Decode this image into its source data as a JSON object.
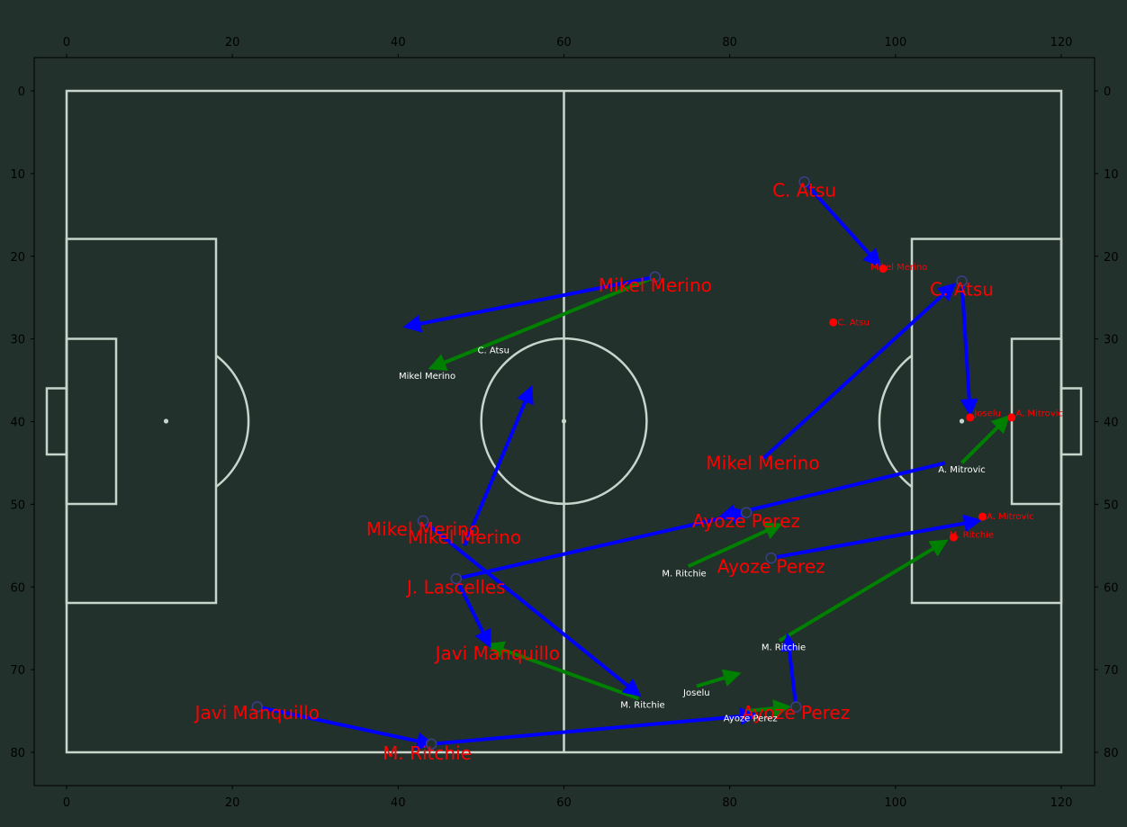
{
  "x_ticks": [
    "0",
    "20",
    "40",
    "60",
    "80",
    "100",
    "120"
  ],
  "y_ticks": [
    "0",
    "10",
    "20",
    "30",
    "40",
    "50",
    "60",
    "70",
    "80"
  ],
  "colors": {
    "background": "#22312b",
    "pitch_lines": "#c7d5cc",
    "pass_arrow": "#0000ff",
    "carry_arrow": "#008000",
    "label_red": "#ff0000",
    "label_white": "#ffffff"
  },
  "passes": [
    {
      "from": [
        71,
        22.5
      ],
      "to": [
        41,
        28.5
      ]
    },
    {
      "from": [
        89,
        11
      ],
      "to": [
        98,
        21
      ]
    },
    {
      "from": [
        108,
        23
      ],
      "to": [
        109,
        39
      ]
    },
    {
      "from": [
        84,
        44.5
      ],
      "to": [
        107,
        23.5
      ]
    },
    {
      "from": [
        106,
        45
      ],
      "to": [
        79,
        51.5
      ]
    },
    {
      "from": [
        85,
        56.5
      ],
      "to": [
        110,
        52
      ]
    },
    {
      "from": [
        47,
        59
      ],
      "to": [
        82,
        51
      ]
    },
    {
      "from": [
        47,
        59
      ],
      "to": [
        51,
        67
      ]
    },
    {
      "from": [
        48,
        55
      ],
      "to": [
        56,
        36
      ]
    },
    {
      "from": [
        43,
        52
      ],
      "to": [
        69,
        73
      ]
    },
    {
      "from": [
        23,
        74.5
      ],
      "to": [
        44,
        79
      ]
    },
    {
      "from": [
        44,
        79
      ],
      "to": [
        83,
        75.5
      ]
    },
    {
      "from": [
        88,
        74.5
      ],
      "to": [
        87,
        66
      ]
    }
  ],
  "carries": [
    {
      "from": [
        71,
        22.5
      ],
      "to": [
        44,
        33.5
      ]
    },
    {
      "from": [
        69,
        73.5
      ],
      "to": [
        51,
        67
      ]
    },
    {
      "from": [
        75,
        57.5
      ],
      "to": [
        86,
        52.5
      ]
    },
    {
      "from": [
        76,
        72
      ],
      "to": [
        81,
        70.5
      ]
    },
    {
      "from": [
        82,
        75
      ],
      "to": [
        87,
        74.5
      ]
    },
    {
      "from": [
        86,
        66.5
      ],
      "to": [
        106,
        54.5
      ]
    },
    {
      "from": [
        108,
        45
      ],
      "to": [
        113.5,
        39.5
      ]
    }
  ],
  "start_markers": [
    {
      "pos": [
        71,
        22.5
      ]
    },
    {
      "pos": [
        89,
        11
      ]
    },
    {
      "pos": [
        108,
        23
      ]
    },
    {
      "pos": [
        43,
        52
      ]
    },
    {
      "pos": [
        47,
        59
      ]
    },
    {
      "pos": [
        23,
        74.5
      ]
    },
    {
      "pos": [
        44,
        79
      ]
    },
    {
      "pos": [
        82,
        51
      ]
    },
    {
      "pos": [
        85,
        56.5
      ]
    },
    {
      "pos": [
        88,
        74.5
      ]
    }
  ],
  "end_points": [
    {
      "pos": [
        98.5,
        21.5
      ]
    },
    {
      "pos": [
        92.5,
        28
      ]
    },
    {
      "pos": [
        109,
        39.5
      ]
    },
    {
      "pos": [
        114,
        39.5
      ]
    },
    {
      "pos": [
        110.5,
        51.5
      ]
    },
    {
      "pos": [
        107,
        54
      ]
    }
  ],
  "player_labels": [
    {
      "text": "C. Atsu",
      "pos": [
        89,
        12
      ]
    },
    {
      "text": "Mikel Merino",
      "pos": [
        71,
        23.5
      ]
    },
    {
      "text": "C. Atsu",
      "pos": [
        108,
        24
      ]
    },
    {
      "text": "Mikel Merino",
      "pos": [
        84,
        45
      ]
    },
    {
      "text": "Ayoze Perez",
      "pos": [
        82,
        52
      ]
    },
    {
      "text": "Ayoze Perez",
      "pos": [
        85,
        57.5
      ]
    },
    {
      "text": "Mikel Merino",
      "pos": [
        43,
        53
      ]
    },
    {
      "text": "Mikel Merino",
      "pos": [
        48,
        54
      ]
    },
    {
      "text": "J. Lascelles",
      "pos": [
        47,
        60
      ]
    },
    {
      "text": "Javi Manquillo",
      "pos": [
        52,
        68
      ]
    },
    {
      "text": "Javi Manquillo",
      "pos": [
        23,
        75.2
      ]
    },
    {
      "text": "M. Ritchie",
      "pos": [
        43.5,
        80.1
      ]
    },
    {
      "text": "Ayoze Perez",
      "pos": [
        88,
        75.2
      ]
    }
  ],
  "carry_labels": [
    {
      "text": "C. Atsu",
      "pos": [
        51.5,
        31.3
      ]
    },
    {
      "text": "Mikel Merino",
      "pos": [
        43.5,
        34.4
      ]
    },
    {
      "text": "A. Mitrovic",
      "pos": [
        108,
        45.7
      ]
    },
    {
      "text": "M. Ritchie",
      "pos": [
        74.5,
        58.3
      ]
    },
    {
      "text": "M. Ritchie",
      "pos": [
        86.5,
        67.2
      ]
    },
    {
      "text": "Joselu",
      "pos": [
        76,
        72.7
      ]
    },
    {
      "text": "M. Ritchie",
      "pos": [
        69.5,
        74.2
      ]
    },
    {
      "text": "Ayoze Perez",
      "pos": [
        82.5,
        75.8
      ]
    }
  ],
  "end_labels": [
    {
      "text": "Mikel Merino",
      "pos": [
        97,
        21.2
      ]
    },
    {
      "text": "C. Atsu",
      "pos": [
        93,
        27.9
      ]
    },
    {
      "text": "Joselu",
      "pos": [
        109.5,
        38.9
      ]
    },
    {
      "text": "A. Mitrovic",
      "pos": [
        114.5,
        38.9
      ]
    },
    {
      "text": "A. Mitrovic",
      "pos": [
        111,
        51.4
      ]
    },
    {
      "text": "M. Ritchie",
      "pos": [
        106.5,
        53.6
      ]
    }
  ]
}
